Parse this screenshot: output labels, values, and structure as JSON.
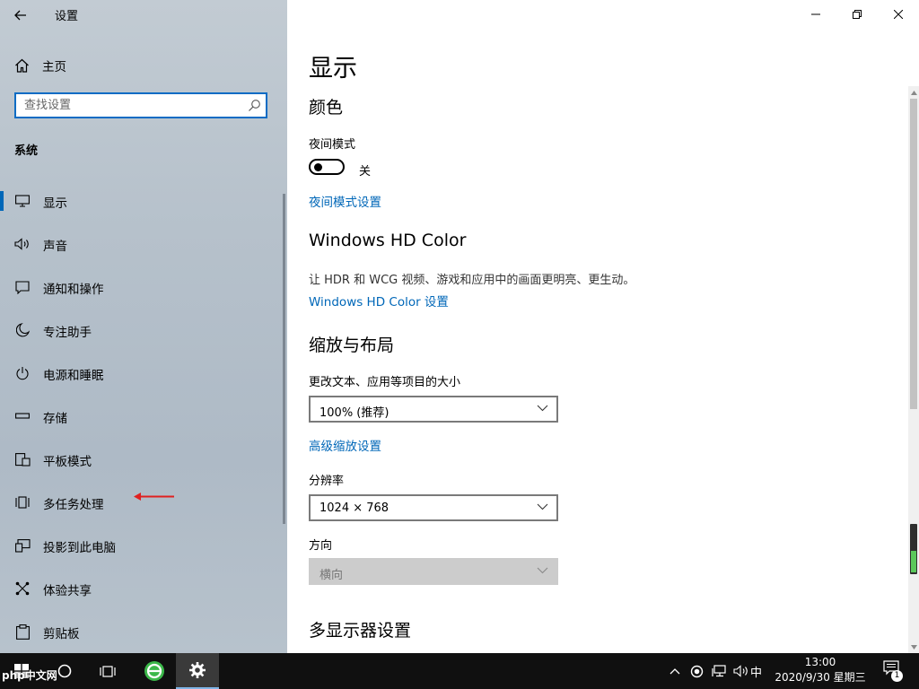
{
  "window": {
    "title": "设置"
  },
  "sidebar": {
    "home_label": "主页",
    "search_placeholder": "查找设置",
    "section_title": "系统",
    "items": [
      {
        "label": "显示",
        "icon": "monitor-icon",
        "active": true
      },
      {
        "label": "声音",
        "icon": "speaker-icon"
      },
      {
        "label": "通知和操作",
        "icon": "notification-icon"
      },
      {
        "label": "专注助手",
        "icon": "moon-icon"
      },
      {
        "label": "电源和睡眠",
        "icon": "power-icon"
      },
      {
        "label": "存储",
        "icon": "storage-icon"
      },
      {
        "label": "平板模式",
        "icon": "tablet-icon"
      },
      {
        "label": "多任务处理",
        "icon": "multitask-icon"
      },
      {
        "label": "投影到此电脑",
        "icon": "project-icon"
      },
      {
        "label": "体验共享",
        "icon": "share-icon"
      },
      {
        "label": "剪贴板",
        "icon": "clipboard-icon"
      }
    ]
  },
  "main": {
    "page_title": "显示",
    "color": {
      "heading": "颜色",
      "night_mode_label": "夜间模式",
      "night_mode_state": "关",
      "night_mode_on": false,
      "night_mode_link": "夜间模式设置"
    },
    "hdr": {
      "heading": "Windows HD Color",
      "description": "让 HDR 和 WCG 视频、游戏和应用中的画面更明亮、更生动。",
      "link": "Windows HD Color 设置"
    },
    "scale": {
      "heading": "缩放与布局",
      "text_size_label": "更改文本、应用等项目的大小",
      "text_size_value": "100% (推荐)",
      "advanced_link": "高级缩放设置",
      "resolution_label": "分辨率",
      "resolution_value": "1024 × 768",
      "orientation_label": "方向",
      "orientation_value": "横向"
    },
    "multi_display": {
      "heading": "多显示器设置"
    }
  },
  "taskbar": {
    "time": "13:00",
    "date": "2020/9/30 星期三",
    "ime": "中",
    "notification_count": "1"
  },
  "watermark": "php中文网",
  "colors": {
    "accent": "#0067b8",
    "search_border": "#0a6cc4",
    "taskbar": "#101010",
    "arrow": "#e02020"
  }
}
